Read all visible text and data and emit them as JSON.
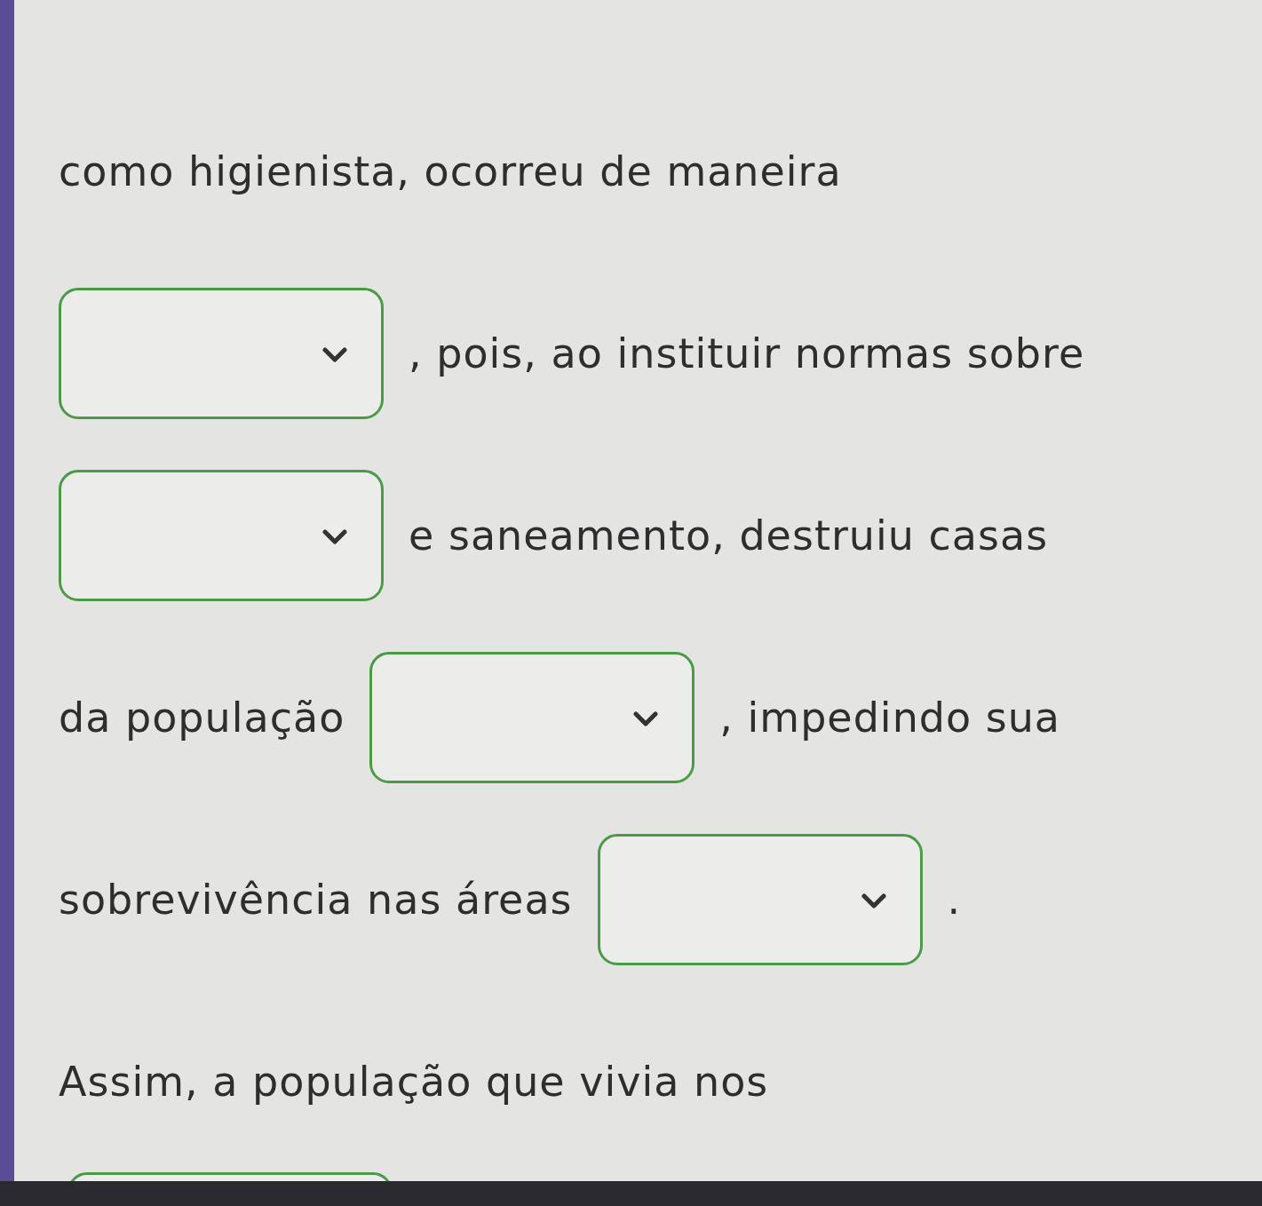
{
  "lines": [
    [
      {
        "kind": "text",
        "text": "como higienista, ocorreu de maneira"
      }
    ],
    [
      {
        "kind": "dropdown"
      },
      {
        "kind": "text",
        "text": ", pois, ao instituir normas sobre"
      }
    ],
    [
      {
        "kind": "dropdown"
      },
      {
        "kind": "text",
        "text": "e saneamento, destruiu casas"
      }
    ],
    [
      {
        "kind": "text",
        "text": "da população"
      },
      {
        "kind": "dropdown"
      },
      {
        "kind": "text",
        "text": ", impedindo sua"
      }
    ],
    [
      {
        "kind": "text",
        "text": "sobrevivência nas áreas"
      },
      {
        "kind": "dropdown"
      },
      {
        "kind": "text",
        "text": "."
      }
    ],
    [
      {
        "kind": "text",
        "text": "Assim, a população que vivia nos"
      }
    ]
  ],
  "cut_line": [
    {
      "kind": "dropdown"
    }
  ]
}
